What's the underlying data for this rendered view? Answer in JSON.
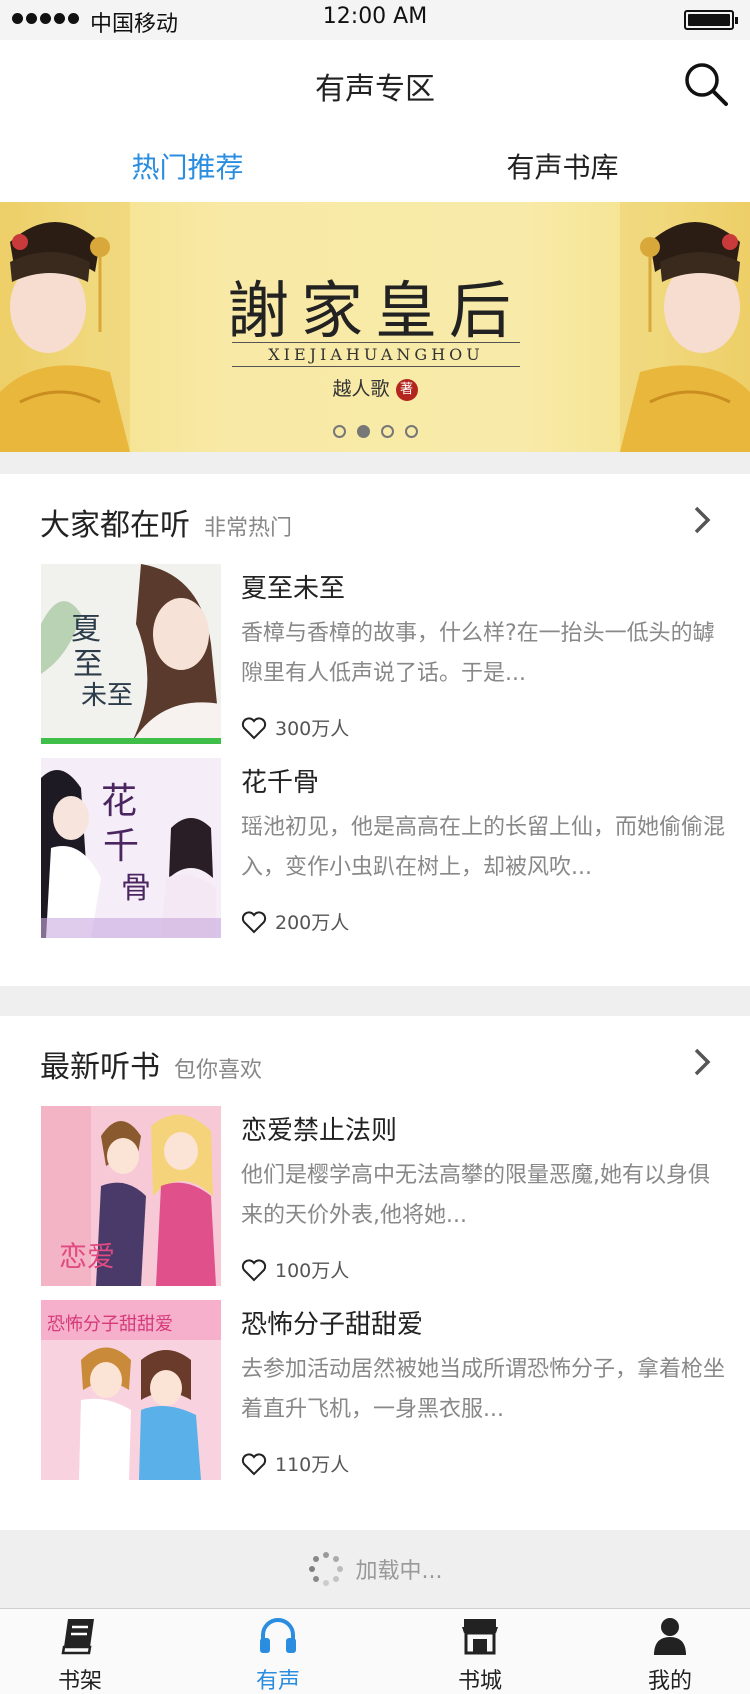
{
  "status_bar": {
    "carrier": "中国移动",
    "time": "12:00 AM"
  },
  "header": {
    "title": "有声专区"
  },
  "tabs": [
    {
      "label": "热门推荐",
      "active": true
    },
    {
      "label": "有声书库",
      "active": false
    }
  ],
  "banner": {
    "title": "謝家皇后",
    "pinyin": "XIEJIAHUANGHOU",
    "author": "越人歌",
    "seal": "著",
    "pages": 4,
    "active_page": 2
  },
  "sections": [
    {
      "title": "大家都在听",
      "subtitle": "非常热门",
      "books": [
        {
          "title": "夏至未至",
          "desc": "香樟与香樟的故事，什么样?在一抬头一低头的罅隙里有人低声说了话。于是...",
          "likes": "300万人",
          "cover_text": "夏至未至"
        },
        {
          "title": "花千骨",
          "desc": "瑶池初见，他是高高在上的长留上仙，而她偷偷混入，变作小虫趴在树上，却被风吹...",
          "likes": "200万人",
          "cover_text": "花千骨"
        }
      ]
    },
    {
      "title": "最新听书",
      "subtitle": "包你喜欢",
      "books": [
        {
          "title": "恋爱禁止法则",
          "desc": "他们是樱学高中无法高攀的限量恶魔,她有以身俱来的天价外表,他将她...",
          "likes": "100万人",
          "cover_text": "恋爱"
        },
        {
          "title": "恐怖分子甜甜爱",
          "desc": "去参加活动居然被她当成所谓恐怖分子，拿着枪坐着直升飞机，一身黑衣服...",
          "likes": "110万人",
          "cover_text": "恐怖分子甜甜爱"
        }
      ]
    }
  ],
  "loading_text": "加载中...",
  "bottom_nav": [
    {
      "label": "书架",
      "icon": "book-icon",
      "active": false
    },
    {
      "label": "有声",
      "icon": "headphones-icon",
      "active": true
    },
    {
      "label": "书城",
      "icon": "store-icon",
      "active": false
    },
    {
      "label": "我的",
      "icon": "person-icon",
      "active": false
    }
  ],
  "colors": {
    "accent": "#2a8de0",
    "banner_bg": "#f8eaa8",
    "gray_text": "#888888",
    "gap": "#efefef"
  }
}
